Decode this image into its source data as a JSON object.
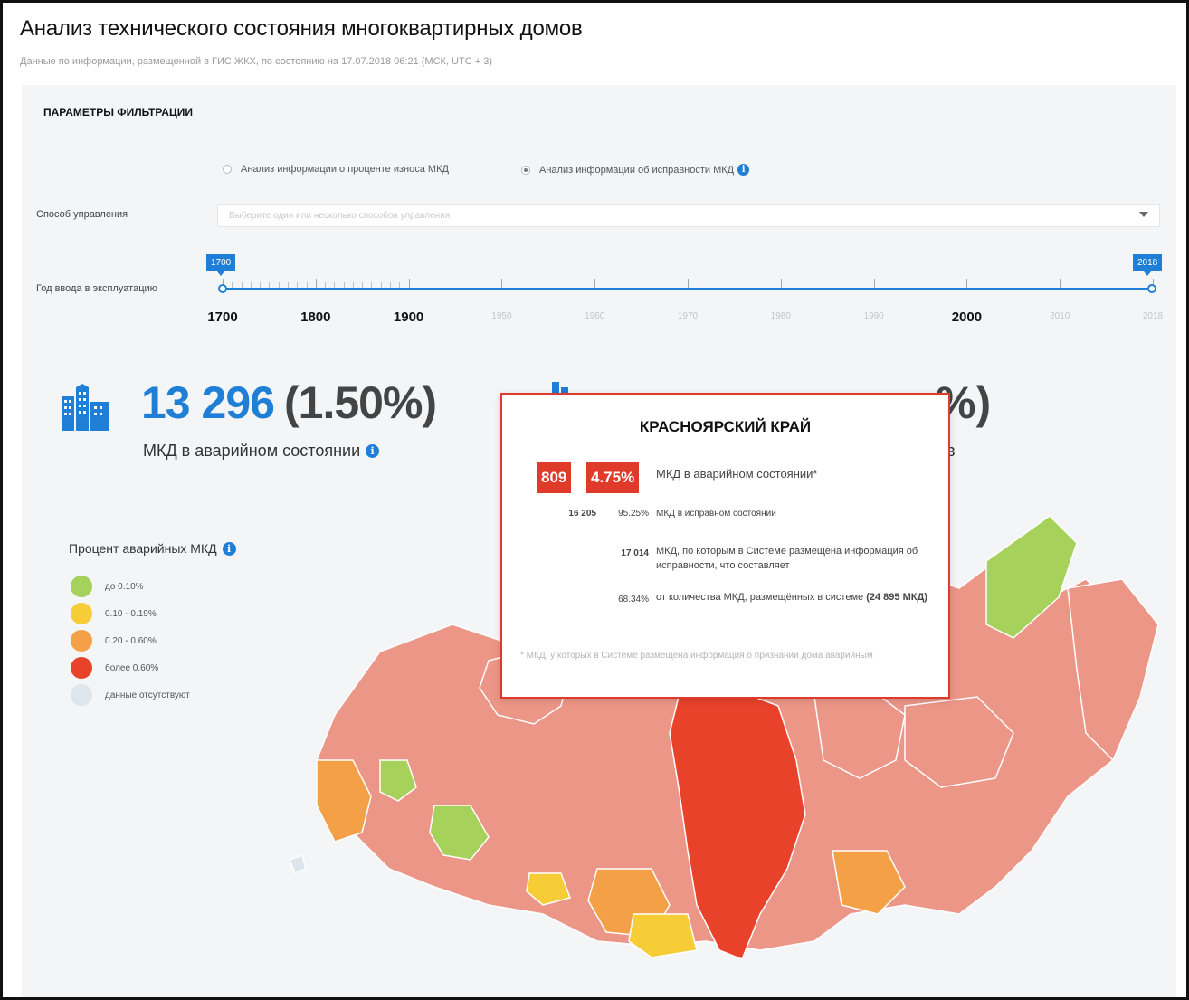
{
  "page": {
    "title": "Анализ технического состояния многоквартирных домов",
    "subtitle": "Данные по информации, размещенной в ГИС ЖКХ, по состоянию на 17.07.2018 06:21 (МСК, UTC + 3)"
  },
  "filters": {
    "header": "ПАРАМЕТРЫ ФИЛЬТРАЦИИ",
    "radio_wear": "Анализ информации о проценте износа МКД",
    "radio_condition": "Анализ информации об исправности МКД",
    "management_label": "Способ управления",
    "management_placeholder": "Выберите один или несколько способов управления",
    "year_label": "Год ввода в эксплуатацию",
    "year_from": "1700",
    "year_to": "2018",
    "year_ticks": [
      {
        "label": "1700",
        "major": true
      },
      {
        "label": "1800",
        "major": true
      },
      {
        "label": "1900",
        "major": true
      },
      {
        "label": "1950",
        "major": false
      },
      {
        "label": "1960",
        "major": false
      },
      {
        "label": "1970",
        "major": false
      },
      {
        "label": "1980",
        "major": false
      },
      {
        "label": "1990",
        "major": false
      },
      {
        "label": "2000",
        "major": true
      },
      {
        "label": "2010",
        "major": false
      },
      {
        "label": "2018",
        "major": false
      }
    ]
  },
  "stats": {
    "emergency_count": "13 296",
    "emergency_percent": "(1.50%)",
    "emergency_caption": "МКД в аварийном состоянии",
    "second_tail": "%)",
    "second_caption_tail": "в"
  },
  "legend": {
    "title": "Процент аварийных МКД",
    "items": [
      {
        "label": "до 0.10%",
        "color": "#a6d15a"
      },
      {
        "label": "0.10 - 0.19%",
        "color": "#f6cd36"
      },
      {
        "label": "0.20 - 0.60%",
        "color": "#f3a046"
      },
      {
        "label": "более 0.60%",
        "color": "#e8422b"
      },
      {
        "label": "данные отсутствуют",
        "color": "#dde6ec"
      }
    ]
  },
  "tooltip": {
    "region": "КРАСНОЯРСКИЙ КРАЙ",
    "emergency_count": "809",
    "emergency_percent": "4.75%",
    "emergency_label": "МКД в аварийном состоянии*",
    "ok_count": "16 205",
    "ok_percent": "95.25%",
    "ok_label": "МКД в исправном состоянии",
    "total_count": "17 014",
    "total_label": "МКД, по которым в Системе размещена информация об исправности, что составляет",
    "share_percent": "68.34%",
    "share_label_prefix": "от количества МКД, размещённых в системе",
    "share_label_bold": "(24 895 МКД)",
    "footnote": "* МКД, у которых в Системе размещена информация о признании дома аварийным"
  },
  "colors": {
    "accent": "#1f7fd6",
    "danger": "#e03b2a"
  }
}
